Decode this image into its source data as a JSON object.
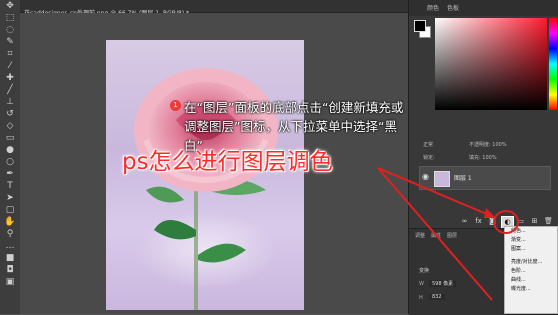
{
  "document": {
    "tab_title": "花caddesigner_cn处理前.png @ 66.7% (图层 1, RGB/8) *"
  },
  "toolbar": {
    "tools": [
      "move-icon",
      "marquee-icon",
      "lasso-icon",
      "quick-select-icon",
      "crop-icon",
      "eyedropper-icon",
      "healing-icon",
      "brush-icon",
      "stamp-icon",
      "history-brush-icon",
      "eraser-icon",
      "gradient-icon",
      "blur-icon",
      "dodge-icon",
      "pen-icon",
      "type-icon",
      "path-select-icon",
      "shape-icon",
      "hand-icon",
      "zoom-icon"
    ]
  },
  "right_panel": {
    "tabs": [
      "颜色",
      "色板"
    ],
    "layers": {
      "mode": "正常",
      "opacity_label": "不透明度:",
      "opacity_value": "100%",
      "lock_label": "锁定:",
      "fill_label": "填充:",
      "fill_value": "100%",
      "layer_name": "图层 1"
    },
    "bottom_icons": [
      "link-icon",
      "fx-icon",
      "mask-icon",
      "adjustment-layer-icon",
      "folder-icon",
      "new-layer-icon",
      "trash-icon"
    ],
    "properties": {
      "tabs": [
        "调整",
        "属性",
        "图层"
      ],
      "transform_label": "变换",
      "w_label": "W",
      "w_value": "598 像素",
      "h_label": "H",
      "h_value": "832"
    }
  },
  "dropdown_menu": {
    "items": [
      "纯色...",
      "渐变...",
      "图案...",
      "亮度/对比度...",
      "色阶...",
      "曲线...",
      "曝光度..."
    ]
  },
  "annotation": {
    "step_number": "1",
    "text": "在“图层”面板的底部点击“创建新填充或调整图层”图标，从下拉菜单中选择“黑白”"
  },
  "headline": "ps怎么进行图层调色",
  "colors": {
    "accent_red": "#e02020",
    "headline_red": "#ff2a2a",
    "panel_dark": "#383838"
  }
}
